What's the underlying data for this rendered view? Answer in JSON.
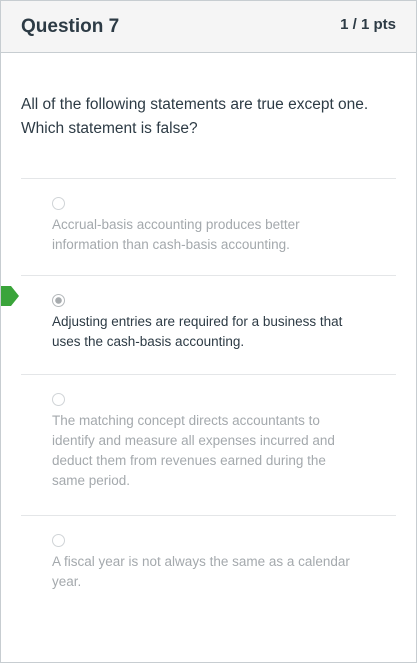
{
  "question": {
    "title": "Question 7",
    "points": "1 / 1 pts",
    "text": "All of the following statements are true except one. Which statement is false?"
  },
  "answers": [
    {
      "text": "Accrual-basis accounting produces better information than cash-basis accounting.",
      "selected": false
    },
    {
      "text": "Adjusting entries are required for a business that uses the cash-basis accounting.",
      "selected": true
    },
    {
      "text": "The matching concept directs accountants to identify and measure all expenses incurred and deduct them from revenues earned during the same period.",
      "selected": false
    },
    {
      "text": "A fiscal year is not always the same as a calendar year.",
      "selected": false
    }
  ],
  "colors": {
    "correct_marker": "#3aa43a",
    "text": "#2d3b45",
    "muted_text": "#a4a9ad",
    "header_bg": "#f5f5f5"
  }
}
